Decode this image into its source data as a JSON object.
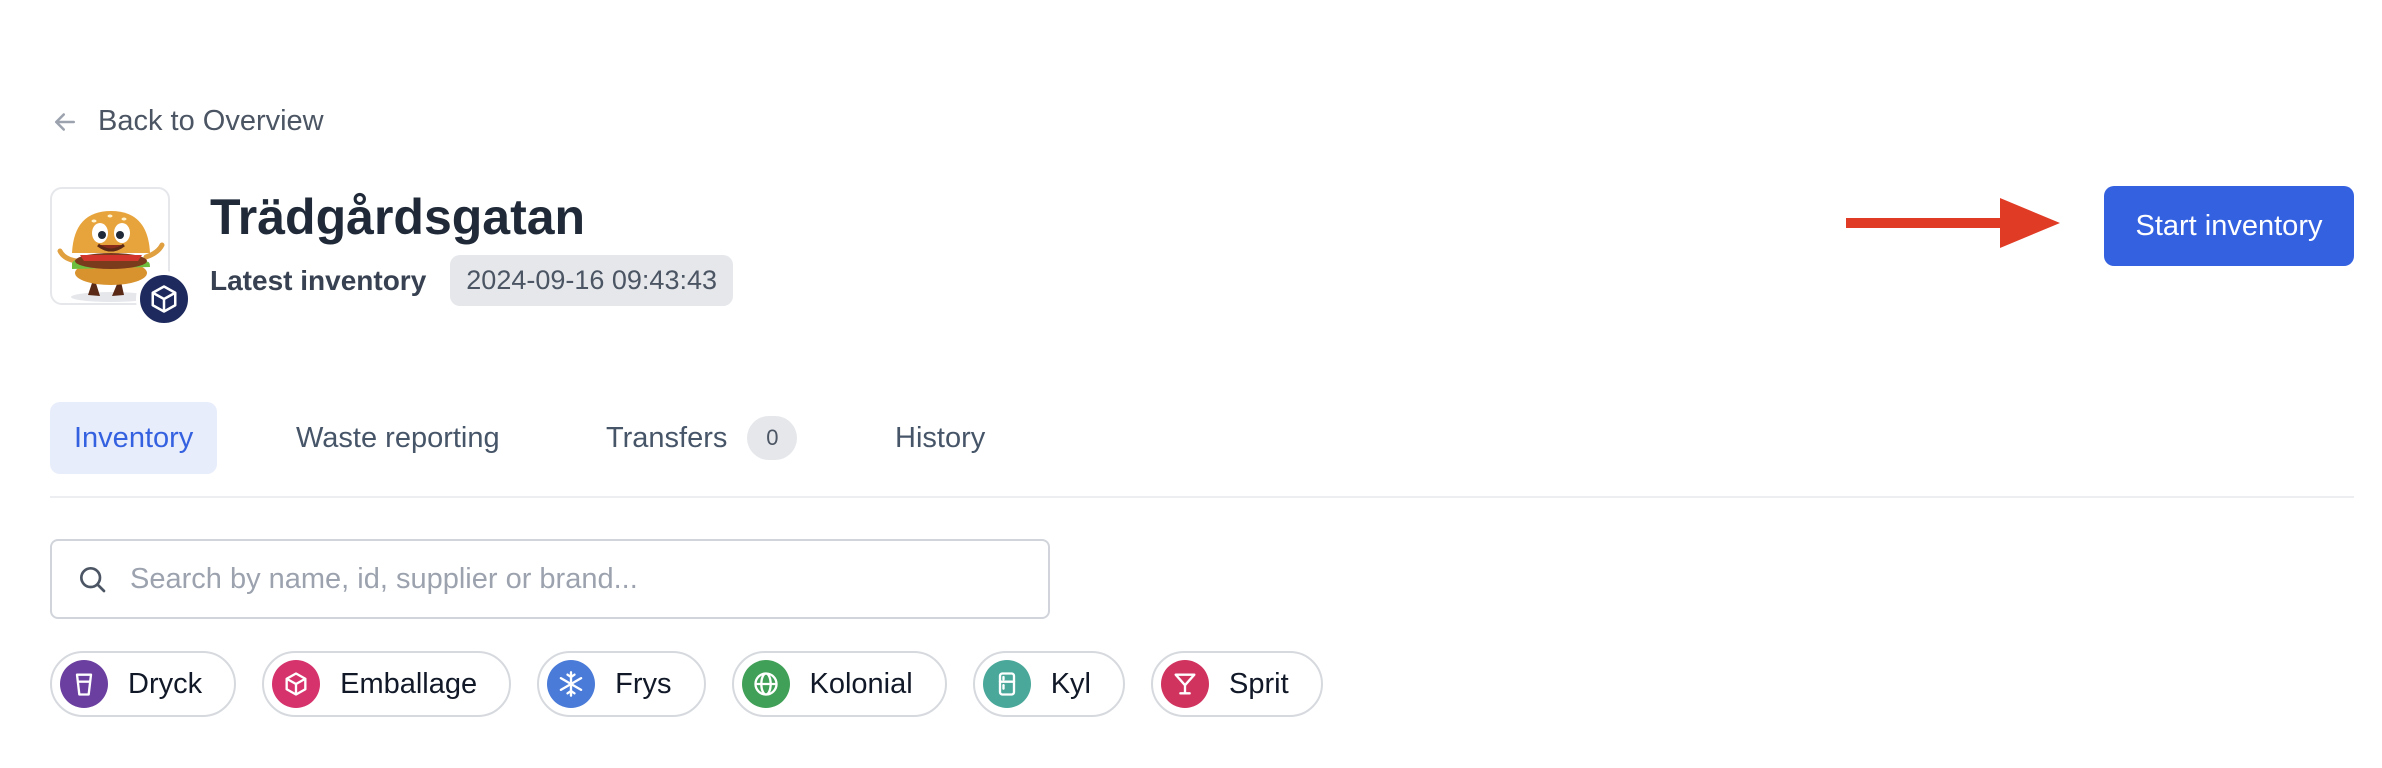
{
  "header": {
    "back_label": "Back to Overview",
    "store_name": "Trädgårdsgatan",
    "latest_label": "Latest inventory",
    "latest_value": "2024-09-16 09:43:43",
    "start_button": "Start inventory"
  },
  "tabs": [
    {
      "label": "Inventory",
      "active": true
    },
    {
      "label": "Waste reporting",
      "active": false
    },
    {
      "label": "Transfers",
      "count": "0",
      "active": false
    },
    {
      "label": "History",
      "active": false
    }
  ],
  "search": {
    "placeholder": "Search by name, id, supplier or brand...",
    "value": ""
  },
  "categories": [
    {
      "label": "Dryck",
      "icon": "cup-icon",
      "color": "#6b3fa0"
    },
    {
      "label": "Emballage",
      "icon": "box-icon",
      "color": "#d6336c"
    },
    {
      "label": "Frys",
      "icon": "snowflake-icon",
      "color": "#4a7bd8"
    },
    {
      "label": "Kolonial",
      "icon": "globe-icon",
      "color": "#40a057"
    },
    {
      "label": "Kyl",
      "icon": "fridge-icon",
      "color": "#4aa89a"
    },
    {
      "label": "Sprit",
      "icon": "cocktail-icon",
      "color": "#d1335f"
    }
  ],
  "colors": {
    "primary": "#3461e0",
    "annotation_arrow": "#e03b24",
    "badge": "#1e2a5e"
  }
}
